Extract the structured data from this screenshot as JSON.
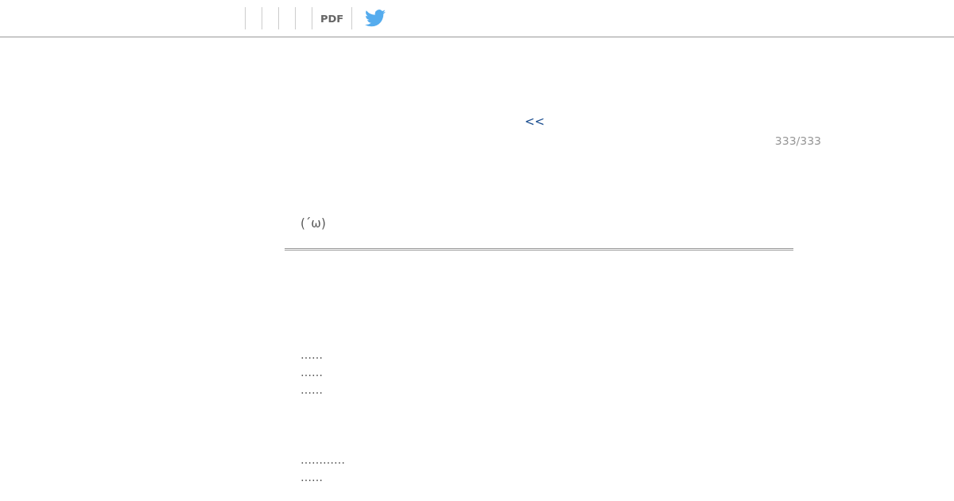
{
  "toolbar": {
    "pdf_label": "PDF"
  },
  "pager": {
    "back_link": "<<",
    "page_count": "333/333"
  },
  "post": {
    "heading": "(´ω)",
    "paragraphs": [
      [
        "……",
        "……",
        "……"
      ],
      [
        "…………",
        "……"
      ]
    ]
  }
}
